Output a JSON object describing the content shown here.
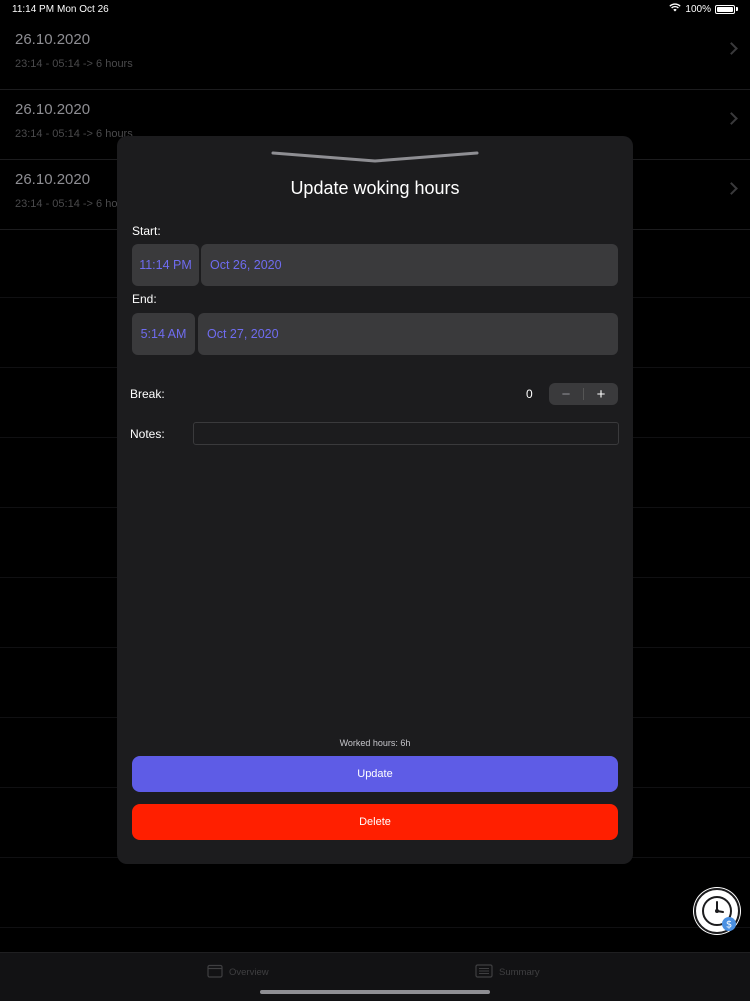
{
  "status_bar": {
    "time": "11:14 PM",
    "date": "Mon Oct 26",
    "battery": "100%"
  },
  "entries": [
    {
      "date": "26.10.2020",
      "range": "23:14 - 05:14 -> 6 hours"
    },
    {
      "date": "26.10.2020",
      "range": "23:14 - 05:14 -> 6 hours"
    },
    {
      "date": "26.10.2020",
      "range": "23:14 - 05:14 -> 6 hours"
    }
  ],
  "modal": {
    "title": "Update woking hours",
    "start_label": "Start:",
    "start_time": "11:14 PM",
    "start_date": "Oct 26, 2020",
    "end_label": "End:",
    "end_time": "5:14 AM",
    "end_date": "Oct 27, 2020",
    "break_label": "Break:",
    "break_value": "0",
    "stepper_minus": "−",
    "stepper_plus": "+",
    "notes_label": "Notes:",
    "notes_value": "",
    "worked_hours": "Worked hours: 6h",
    "update_label": "Update",
    "delete_label": "Delete"
  },
  "tabs": [
    {
      "label": "Overview",
      "icon": "calendar-icon"
    },
    {
      "label": "Summary",
      "icon": "list-icon"
    }
  ],
  "colors": {
    "accent": "#5e5ce6",
    "danger": "#ff1f00",
    "picker_text": "#6f6cf0",
    "modal_bg": "#1c1c1e",
    "field_bg": "#3a3a3c"
  }
}
